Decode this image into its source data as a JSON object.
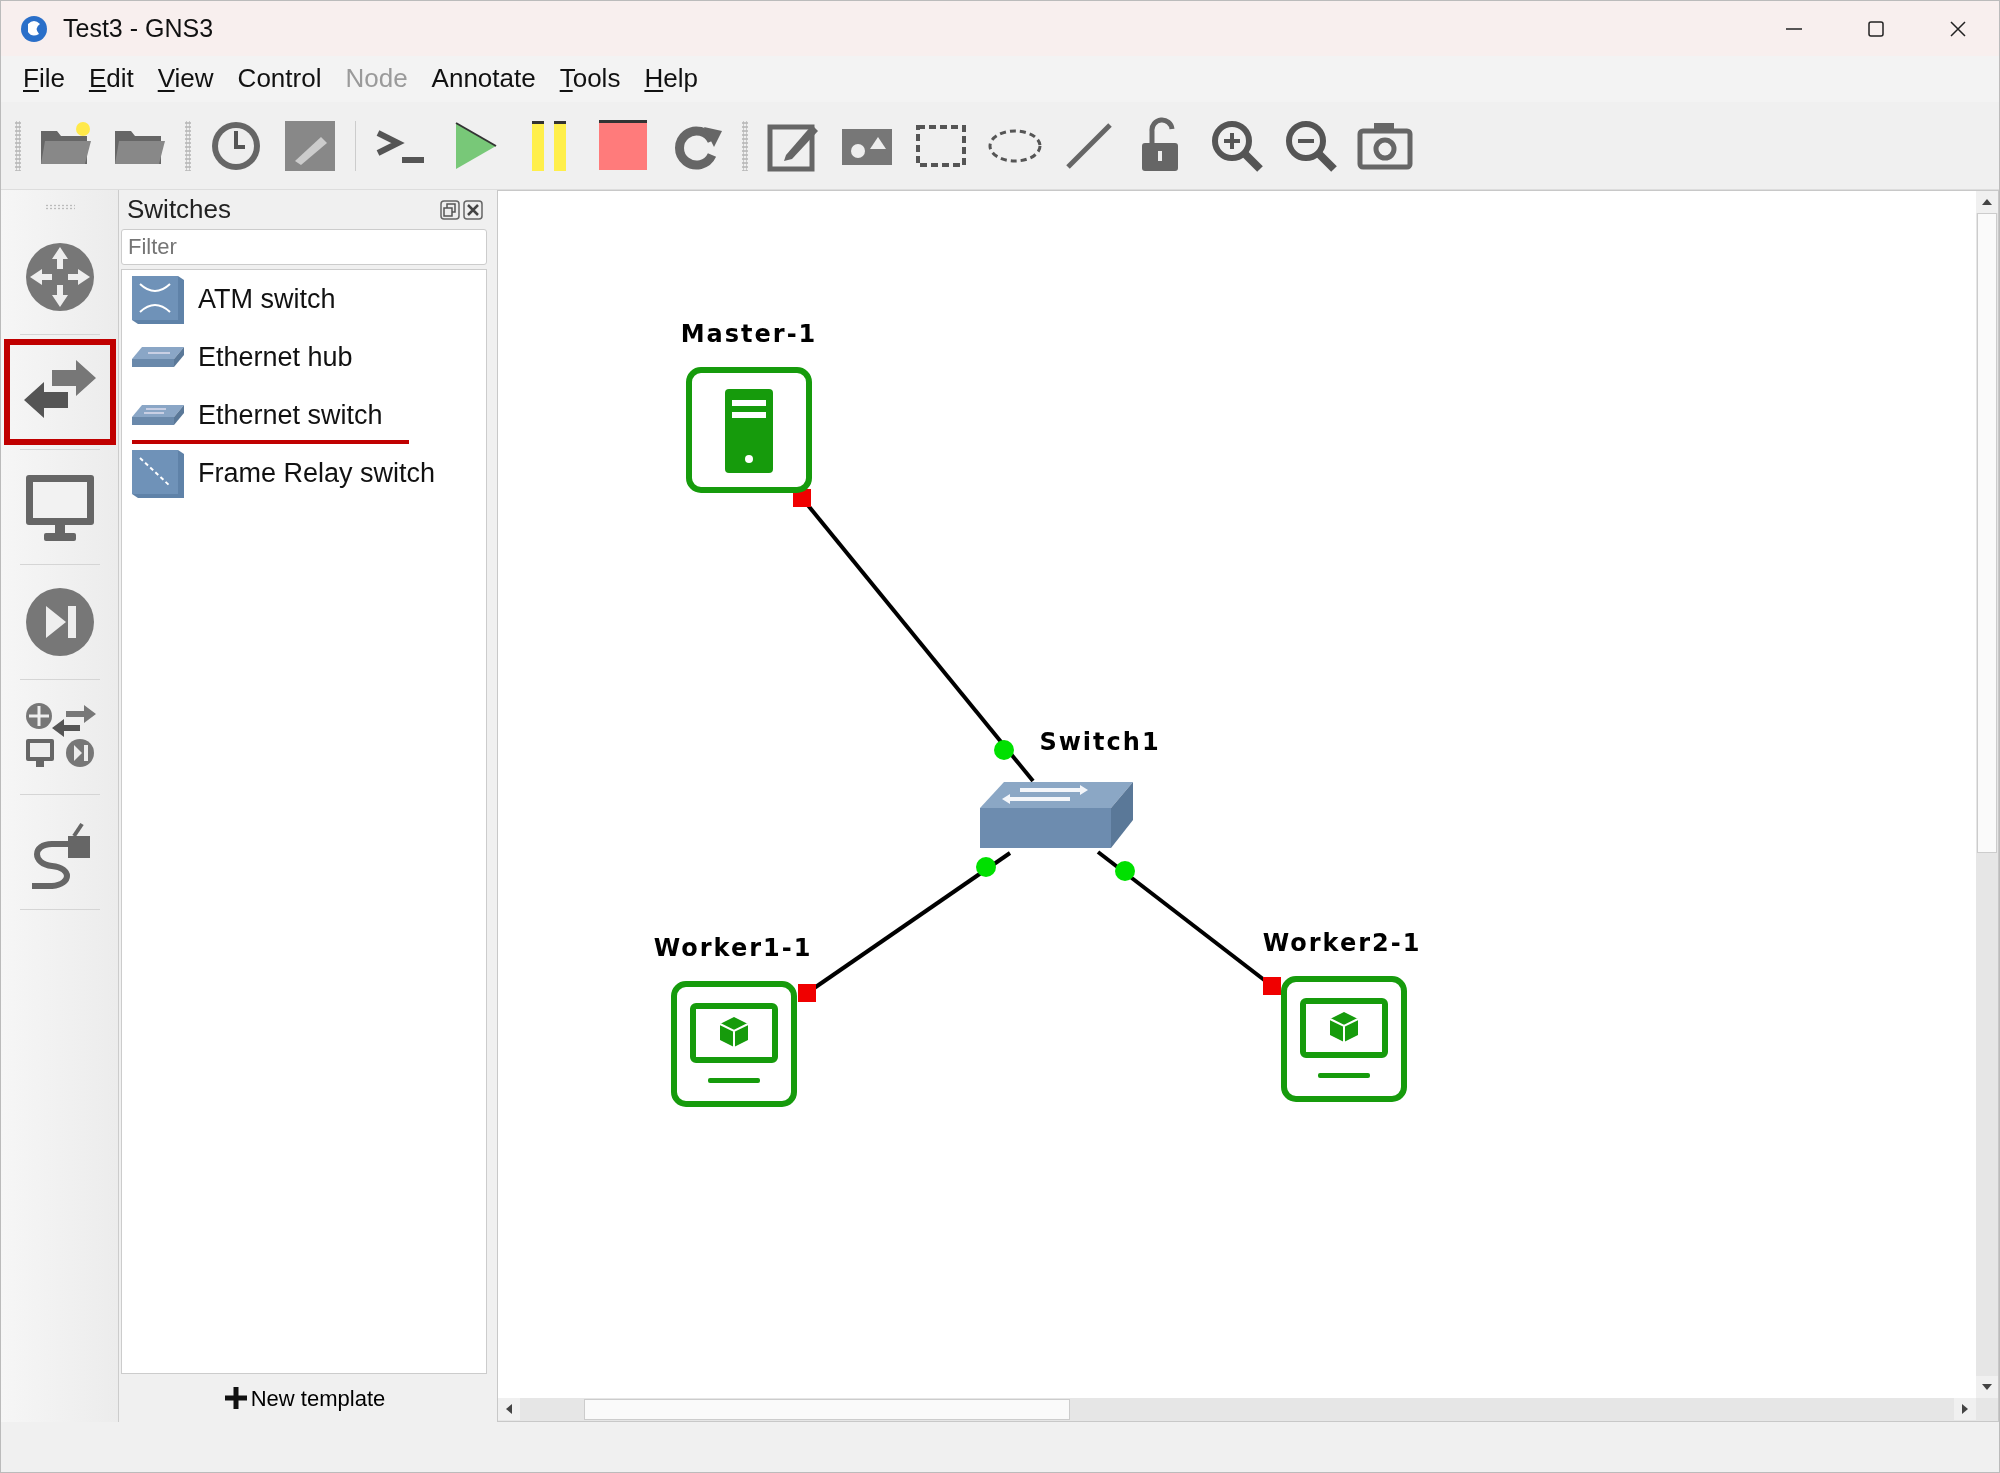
{
  "window": {
    "title": "Test3 - GNS3"
  },
  "menu": [
    {
      "label": "File",
      "mnemonic": true,
      "disabled": false
    },
    {
      "label": "Edit",
      "mnemonic": true,
      "disabled": false
    },
    {
      "label": "View",
      "mnemonic": true,
      "disabled": false
    },
    {
      "label": "Control",
      "mnemonic": false,
      "disabled": false
    },
    {
      "label": "Node",
      "mnemonic": false,
      "disabled": true
    },
    {
      "label": "Annotate",
      "mnemonic": false,
      "disabled": false
    },
    {
      "label": "Tools",
      "mnemonic": true,
      "disabled": false
    },
    {
      "label": "Help",
      "mnemonic": true,
      "disabled": false
    }
  ],
  "categories": [
    {
      "kind": "router",
      "selected": false
    },
    {
      "kind": "switch",
      "selected": true
    },
    {
      "kind": "end-device",
      "selected": false
    },
    {
      "kind": "security",
      "selected": false
    },
    {
      "kind": "all",
      "selected": false
    },
    {
      "kind": "link",
      "selected": false
    }
  ],
  "panel": {
    "title": "Switches",
    "filter": {
      "placeholder": "Filter"
    },
    "items": [
      {
        "label": "ATM switch",
        "kind": "atm",
        "marked": false
      },
      {
        "label": "Ethernet hub",
        "kind": "hub",
        "marked": false
      },
      {
        "label": "Ethernet switch",
        "kind": "switch",
        "marked": true
      },
      {
        "label": "Frame Relay switch",
        "kind": "frame-relay",
        "marked": false
      }
    ],
    "footer_button": "New template"
  },
  "canvas": {
    "nodes": [
      {
        "label": "Master-1",
        "kind": "server",
        "running": false
      },
      {
        "label": "Switch1",
        "kind": "switch",
        "running": true
      },
      {
        "label": "Worker1-1",
        "kind": "vm",
        "running": false
      },
      {
        "label": "Worker2-1",
        "kind": "vm",
        "running": false
      }
    ]
  }
}
